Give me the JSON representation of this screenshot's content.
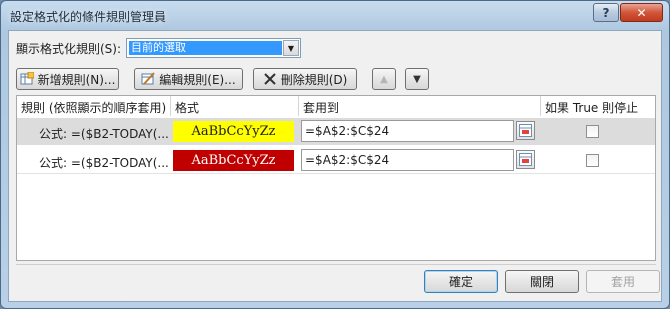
{
  "window": {
    "title": "設定格式化的條件規則管理員",
    "help_label": "?",
    "close_label": "✕"
  },
  "scope": {
    "label": "顯示格式化規則(S):",
    "selected": "目前的選取"
  },
  "toolbar": {
    "new_label": "新增規則(N)...",
    "edit_label": "編輯規則(E)...",
    "delete_label": "刪除規則(D)",
    "up_label": "▲",
    "down_label": "▼"
  },
  "table": {
    "headers": {
      "rule": "規則 (依照顯示的順序套用)",
      "format": "格式",
      "applies_to": "套用到",
      "stop_if_true": "如果 True 則停止"
    },
    "rows": [
      {
        "rule": "公式: =($B2-TODAY(...",
        "format_preview": "AaBbCcYyZz",
        "format_bg": "#ffff00",
        "format_fg": "#1e1e1e",
        "applies_to": "=$A$2:$C$24",
        "stop_if_true": false,
        "selected": true
      },
      {
        "rule": "公式: =($B2-TODAY(...",
        "format_preview": "AaBbCcYyZz",
        "format_bg": "#c00000",
        "format_fg": "#ffffff",
        "applies_to": "=$A$2:$C$24",
        "stop_if_true": false,
        "selected": false
      }
    ]
  },
  "footer": {
    "ok_label": "確定",
    "close_label": "關閉",
    "apply_label": "套用"
  }
}
